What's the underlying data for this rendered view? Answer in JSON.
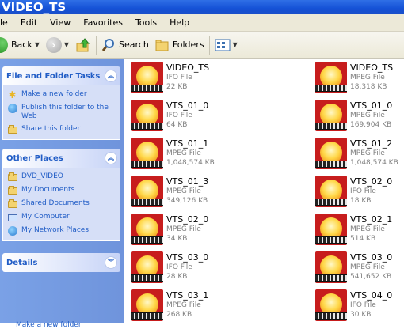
{
  "window": {
    "title": "VIDEO_TS"
  },
  "menu": [
    "le",
    "Edit",
    "View",
    "Favorites",
    "Tools",
    "Help"
  ],
  "toolbar": {
    "back": "Back",
    "search": "Search",
    "folders": "Folders"
  },
  "panels": {
    "tasks": {
      "title": "File and Folder Tasks",
      "items": [
        {
          "label": "Make a new folder",
          "icon": "folder-icon"
        },
        {
          "label": "Publish this folder to the Web",
          "icon": "globe-icon"
        },
        {
          "label": "Share this folder",
          "icon": "share-icon"
        }
      ]
    },
    "places": {
      "title": "Other Places",
      "items": [
        {
          "label": "DVD_VIDEO",
          "icon": "folder-icon"
        },
        {
          "label": "My Documents",
          "icon": "folder-icon"
        },
        {
          "label": "Shared Documents",
          "icon": "folder-icon"
        },
        {
          "label": "My Computer",
          "icon": "computer-icon"
        },
        {
          "label": "My Network Places",
          "icon": "network-icon"
        }
      ]
    },
    "details": {
      "title": "Details"
    }
  },
  "bottom_ghost": "Make a new folder",
  "files": [
    {
      "name": "VIDEO_TS",
      "type": "IFO File",
      "size": "22 KB"
    },
    {
      "name": "VIDEO_TS",
      "type": "MPEG File",
      "size": "18,318 KB"
    },
    {
      "name": "VTS_01_0",
      "type": "IFO File",
      "size": "64 KB"
    },
    {
      "name": "VTS_01_0",
      "type": "MPEG File",
      "size": "169,904 KB"
    },
    {
      "name": "VTS_01_1",
      "type": "MPEG File",
      "size": "1,048,574 KB"
    },
    {
      "name": "VTS_01_2",
      "type": "MPEG File",
      "size": "1,048,574 KB"
    },
    {
      "name": "VTS_01_3",
      "type": "MPEG File",
      "size": "349,126 KB"
    },
    {
      "name": "VTS_02_0",
      "type": "IFO File",
      "size": "18 KB"
    },
    {
      "name": "VTS_02_0",
      "type": "MPEG File",
      "size": "34 KB"
    },
    {
      "name": "VTS_02_1",
      "type": "MPEG File",
      "size": "514 KB"
    },
    {
      "name": "VTS_03_0",
      "type": "IFO File",
      "size": "28 KB"
    },
    {
      "name": "VTS_03_0",
      "type": "MPEG File",
      "size": "541,652 KB"
    },
    {
      "name": "VTS_03_1",
      "type": "MPEG File",
      "size": "268 KB"
    },
    {
      "name": "VTS_04_0",
      "type": "IFO File",
      "size": "30 KB"
    }
  ]
}
